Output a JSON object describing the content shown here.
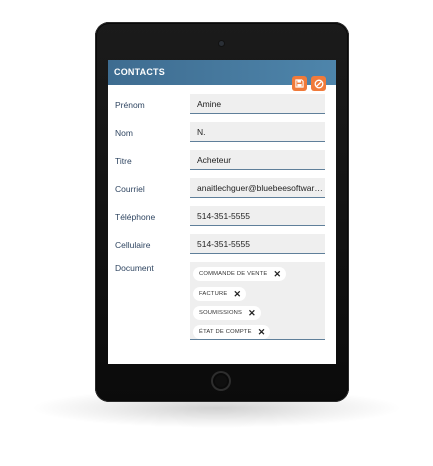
{
  "panel": {
    "title": "CONTACTS",
    "save_icon": "save-icon",
    "cancel_icon": "cancel-icon",
    "accent_color": "#f07a3a",
    "header_color": "#4a7ea5"
  },
  "fields": [
    {
      "label": "Prénom",
      "value": "Amine"
    },
    {
      "label": "Nom",
      "value": "N."
    },
    {
      "label": "Titre",
      "value": "Acheteur"
    },
    {
      "label": "Courriel",
      "value": "anaitlechguer@bluebeesoftware...."
    },
    {
      "label": "Téléphone",
      "value": "514-351-5555"
    },
    {
      "label": "Cellulaire",
      "value": "514-351-5555"
    }
  ],
  "document": {
    "label": "Document",
    "tags": [
      {
        "text": "COMMANDE DE VENTE",
        "remove": "✕"
      },
      {
        "text": "FACTURE",
        "remove": "✕"
      },
      {
        "text": "SOUMISSIONS",
        "remove": "✕"
      },
      {
        "text": "ÉTAT DE COMPTE",
        "remove": "✕"
      }
    ]
  }
}
